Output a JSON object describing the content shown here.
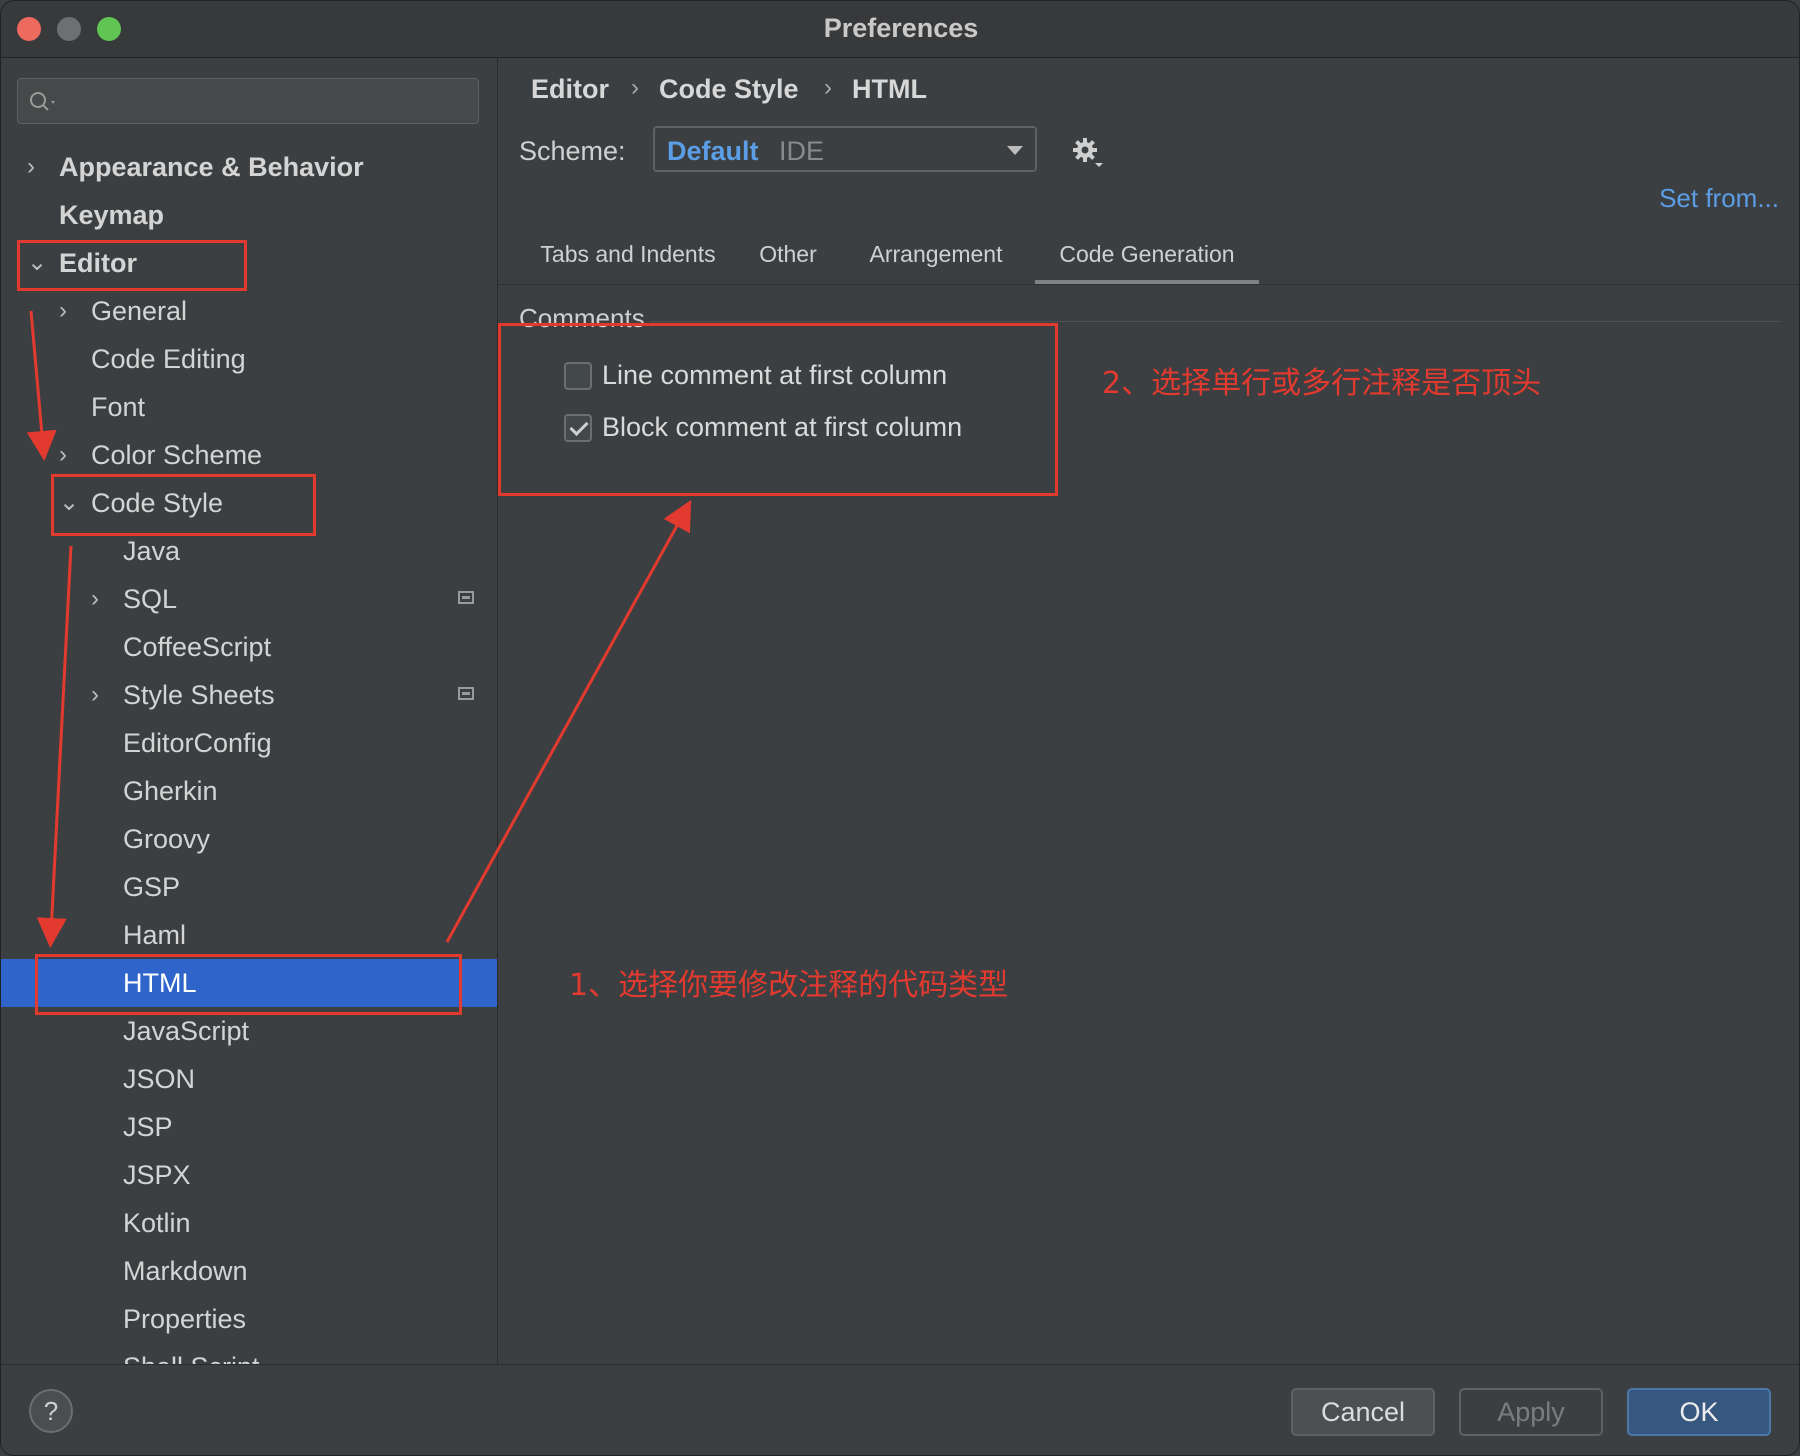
{
  "window": {
    "title": "Preferences"
  },
  "sidebar": {
    "search_placeholder": "",
    "items": [
      {
        "label": "Appearance & Behavior",
        "arrow": "›"
      },
      {
        "label": "Keymap"
      },
      {
        "label": "Editor",
        "arrow": "⌄"
      },
      {
        "label": "General",
        "arrow": "›"
      },
      {
        "label": "Code Editing"
      },
      {
        "label": "Font"
      },
      {
        "label": "Color Scheme",
        "arrow": "›"
      },
      {
        "label": "Code Style",
        "arrow": "⌄"
      },
      {
        "label": "Java"
      },
      {
        "label": "SQL",
        "arrow": "›"
      },
      {
        "label": "CoffeeScript"
      },
      {
        "label": "Style Sheets",
        "arrow": "›"
      },
      {
        "label": "EditorConfig"
      },
      {
        "label": "Gherkin"
      },
      {
        "label": "Groovy"
      },
      {
        "label": "GSP"
      },
      {
        "label": "Haml"
      },
      {
        "label": "HTML"
      },
      {
        "label": "JavaScript"
      },
      {
        "label": "JSON"
      },
      {
        "label": "JSP"
      },
      {
        "label": "JSPX"
      },
      {
        "label": "Kotlin"
      },
      {
        "label": "Markdown"
      },
      {
        "label": "Properties"
      },
      {
        "label": "Shell Script"
      }
    ]
  },
  "breadcrumb": {
    "items": [
      "Editor",
      "Code Style",
      "HTML"
    ],
    "separator": "›"
  },
  "scheme": {
    "label": "Scheme:",
    "value": "Default",
    "qualifier": "IDE"
  },
  "set_from": "Set from...",
  "tabs": [
    "Tabs and Indents",
    "Other",
    "Arrangement",
    "Code Generation"
  ],
  "active_tab": "Code Generation",
  "comments_group": {
    "title": "Comments",
    "options": [
      {
        "label": "Line comment at first column",
        "checked": false
      },
      {
        "label": "Block comment at first column",
        "checked": true
      }
    ]
  },
  "footer": {
    "help": "?",
    "cancel": "Cancel",
    "apply": "Apply",
    "ok": "OK"
  },
  "annotations": {
    "step1": "1、选择你要修改注释的代码类型",
    "step2": "2、选择单行或多行注释是否顶头",
    "color": "#e23a2f"
  },
  "colors": {
    "selection": "#2f65ca",
    "link": "#5b9ee6",
    "background": "#3c3f41"
  }
}
